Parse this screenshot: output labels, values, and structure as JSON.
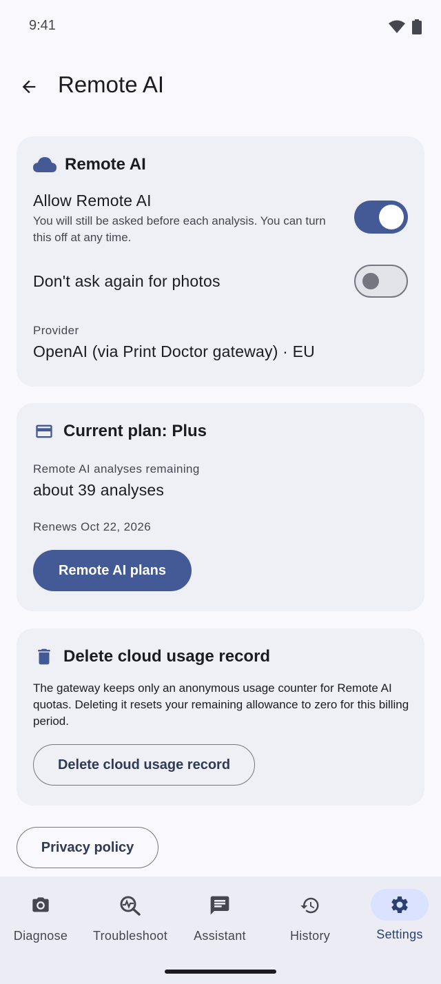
{
  "status_bar": {
    "time": "9:41"
  },
  "header": {
    "title": "Remote AI"
  },
  "remote_ai_card": {
    "heading": "Remote AI",
    "allow": {
      "title": "Allow Remote AI",
      "description": "You will still be asked before each analysis. You can turn this off at any time.",
      "enabled": true
    },
    "dont_ask": {
      "title": "Don't ask again for photos",
      "enabled": false
    },
    "provider_label": "Provider",
    "provider_value": "OpenAI (via Print Doctor gateway) · EU"
  },
  "plan_card": {
    "heading": "Current plan: Plus",
    "remaining_label": "Remote AI analyses remaining",
    "remaining_value": "about 39 analyses",
    "renews": "Renews Oct 22, 2026",
    "plans_button": "Remote AI plans"
  },
  "delete_card": {
    "heading": "Delete cloud usage record",
    "description": "The gateway keeps only an anonymous usage counter for Remote AI quotas. Deleting it resets your remaining allowance to zero for this billing period.",
    "delete_button": "Delete cloud usage record"
  },
  "privacy_button": "Privacy policy",
  "nav": {
    "items": [
      {
        "label": "Diagnose",
        "icon": "camera-icon"
      },
      {
        "label": "Troubleshoot",
        "icon": "troubleshoot-icon"
      },
      {
        "label": "Assistant",
        "icon": "chat-icon"
      },
      {
        "label": "History",
        "icon": "history-icon"
      },
      {
        "label": "Settings",
        "icon": "gear-icon"
      }
    ],
    "active": "Settings"
  },
  "colors": {
    "accent": "#435a96",
    "background": "#f8f8fd",
    "card": "#efeff6",
    "nav_active": "#dae2ff"
  }
}
